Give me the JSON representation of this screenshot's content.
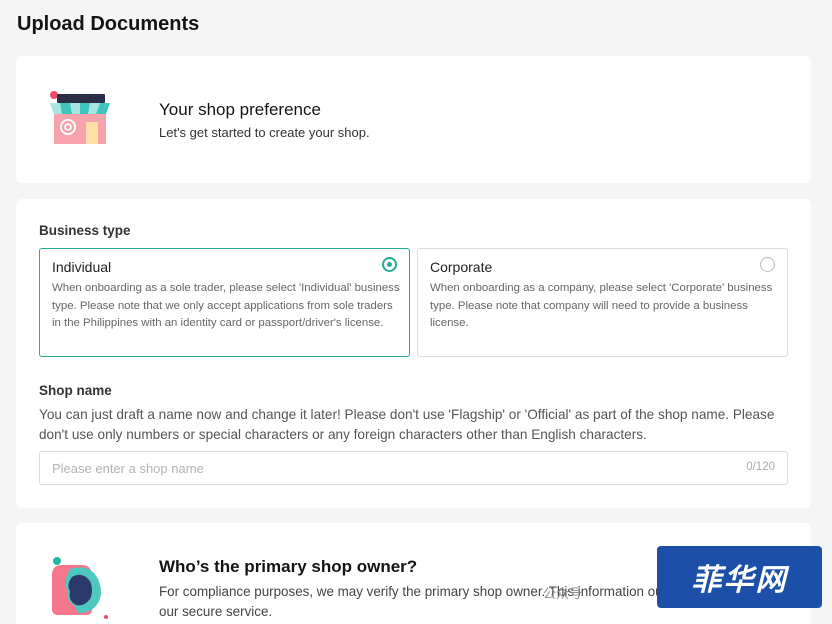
{
  "page": {
    "title": "Upload Documents"
  },
  "preference": {
    "title": "Your shop preference",
    "subtitle": "Let's get started to create your shop.",
    "icon": "shop-storefront-icon"
  },
  "business": {
    "label": "Business type",
    "selected": "Individual",
    "options": [
      {
        "title": "Individual",
        "description": "When onboarding as a sole trader, please select 'Individual' business type. Please note that we only accept applications from sole traders in the Philippines with an identity card or passport/driver's license.",
        "checked": true
      },
      {
        "title": "Corporate",
        "description": "When onboarding as a company, please select 'Corporate' business type. Please note that company will need to provide a business license.",
        "checked": false
      }
    ]
  },
  "shop_name": {
    "label": "Shop name",
    "hint": "You can just draft a name now and change it later! Please don't use 'Flagship' or 'Official' as part of the shop name. Please don't use only numbers or special characters or any foreign characters other than English characters.",
    "placeholder": "Please enter a shop name",
    "value": "",
    "counter": "0/120"
  },
  "owner": {
    "title": "Who’s the primary shop owner?",
    "subtitle": "For compliance purposes, we may verify the primary shop owner. This information outside of our secure service.",
    "icon": "person-profile-icon"
  },
  "watermark": {
    "text": "公众号",
    "logo": "菲华网"
  },
  "colors": {
    "accent": "#26aa99",
    "background": "#f5f5f6"
  }
}
